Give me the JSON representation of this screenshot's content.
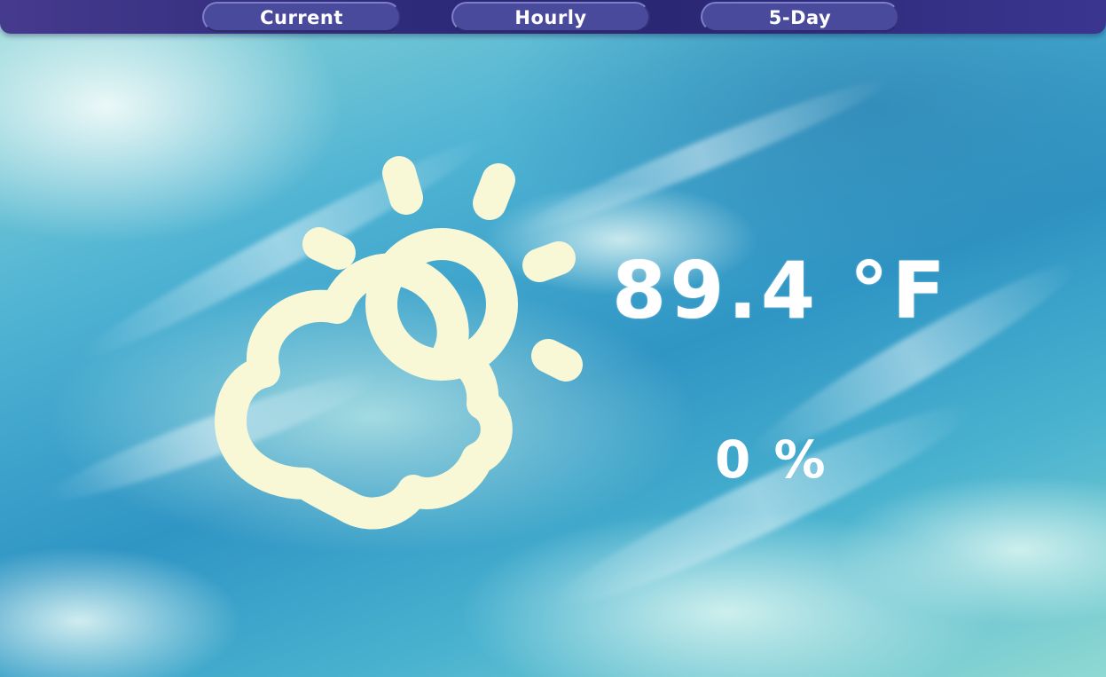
{
  "tabs": [
    {
      "label": "Current"
    },
    {
      "label": "Hourly"
    },
    {
      "label": "5-Day"
    }
  ],
  "current": {
    "condition_icon": "partly-cloudy-icon",
    "temperature": "89.4 °F",
    "precipitation": "0 %"
  },
  "colors": {
    "nav_bar": "#2d2b7a",
    "tab_fill": "#4a4a9c",
    "icon": "#f8f8d6",
    "text": "#ffffff"
  }
}
